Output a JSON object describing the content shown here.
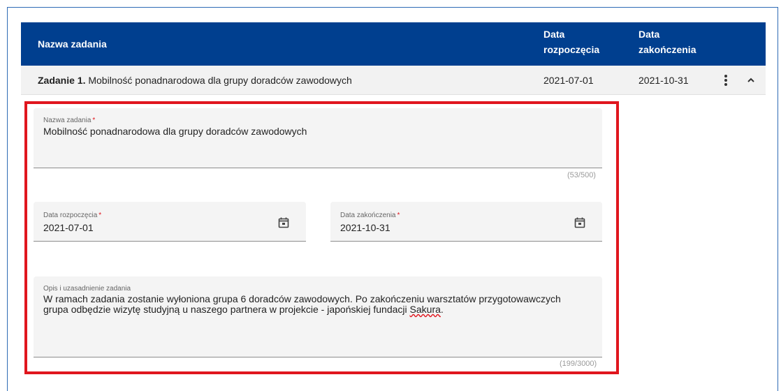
{
  "table": {
    "headers": {
      "name": "Nazwa zadania",
      "start_line1": "Data",
      "start_line2": "rozpoczęcia",
      "end_line1": "Data",
      "end_line2": "zakończenia"
    },
    "row": {
      "prefix": "Zadanie 1.",
      "title": "Mobilność ponadnarodowa dla grupy doradców zawodowych",
      "start": "2021-07-01",
      "end": "2021-10-31",
      "menu_icon": "more-vertical-icon",
      "collapse_icon": "chevron-up-icon"
    }
  },
  "form": {
    "name_field": {
      "label": "Nazwa zadania",
      "required_mark": "*",
      "value": "Mobilność ponadnarodowa dla grupy doradców zawodowych",
      "counter": "(53/500)"
    },
    "start_field": {
      "label": "Data rozpoczęcia",
      "required_mark": "*",
      "value": "2021-07-01",
      "icon": "calendar-icon"
    },
    "end_field": {
      "label": "Data zakończenia",
      "required_mark": "*",
      "value": "2021-10-31",
      "icon": "calendar-icon"
    },
    "desc_field": {
      "label": "Opis i uzasadnienie zadania",
      "value_main": "W ramach zadania zostanie wyłoniona grupa 6 doradców zawodowych. Po zakończeniu warsztatów przygotowawczych\ngrupa odbędzie wizytę studyjną u naszego partnera w projekcie - japońskiej fundacji ",
      "value_misspelled": "Sakura",
      "value_end": ".",
      "counter": "(199/3000)"
    }
  },
  "colors": {
    "header_bg": "#003f8f",
    "highlight": "#e0161e",
    "field_bg": "#f4f4f4"
  }
}
